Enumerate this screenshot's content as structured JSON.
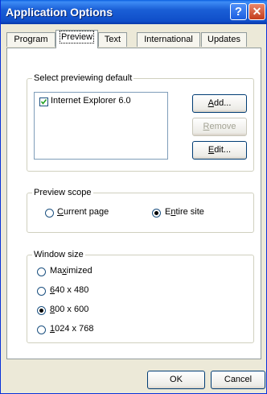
{
  "window": {
    "title": "Application Options",
    "help": "?",
    "close": "✕"
  },
  "tabs": [
    {
      "label": "Program"
    },
    {
      "label": "Preview"
    },
    {
      "label": "Text"
    },
    {
      "label": "International"
    },
    {
      "label": "Updates"
    }
  ],
  "preview_default": {
    "legend": "Select previewing default",
    "browser": "Internet Explorer 6.0",
    "browser_checked": true,
    "add": {
      "before": "",
      "key": "A",
      "after": "dd..."
    },
    "remove": {
      "before": "",
      "key": "R",
      "after": "emove"
    },
    "edit": {
      "before": "",
      "key": "E",
      "after": "dit..."
    }
  },
  "preview_scope": {
    "legend": "Preview scope",
    "current": {
      "before": "",
      "key": "C",
      "after": "urrent page"
    },
    "entire": {
      "before": "E",
      "key": "n",
      "after": "tire site"
    },
    "selected": "entire"
  },
  "window_size": {
    "legend": "Window size",
    "options": [
      {
        "before": "Ma",
        "key": "x",
        "after": "imized"
      },
      {
        "before": "",
        "key": "6",
        "after": "40 x 480"
      },
      {
        "before": "",
        "key": "8",
        "after": "00 x 600"
      },
      {
        "before": "",
        "key": "1",
        "after": "024 x 768"
      }
    ],
    "selected_index": 2
  },
  "buttons": {
    "ok": "OK",
    "cancel": "Cancel"
  }
}
